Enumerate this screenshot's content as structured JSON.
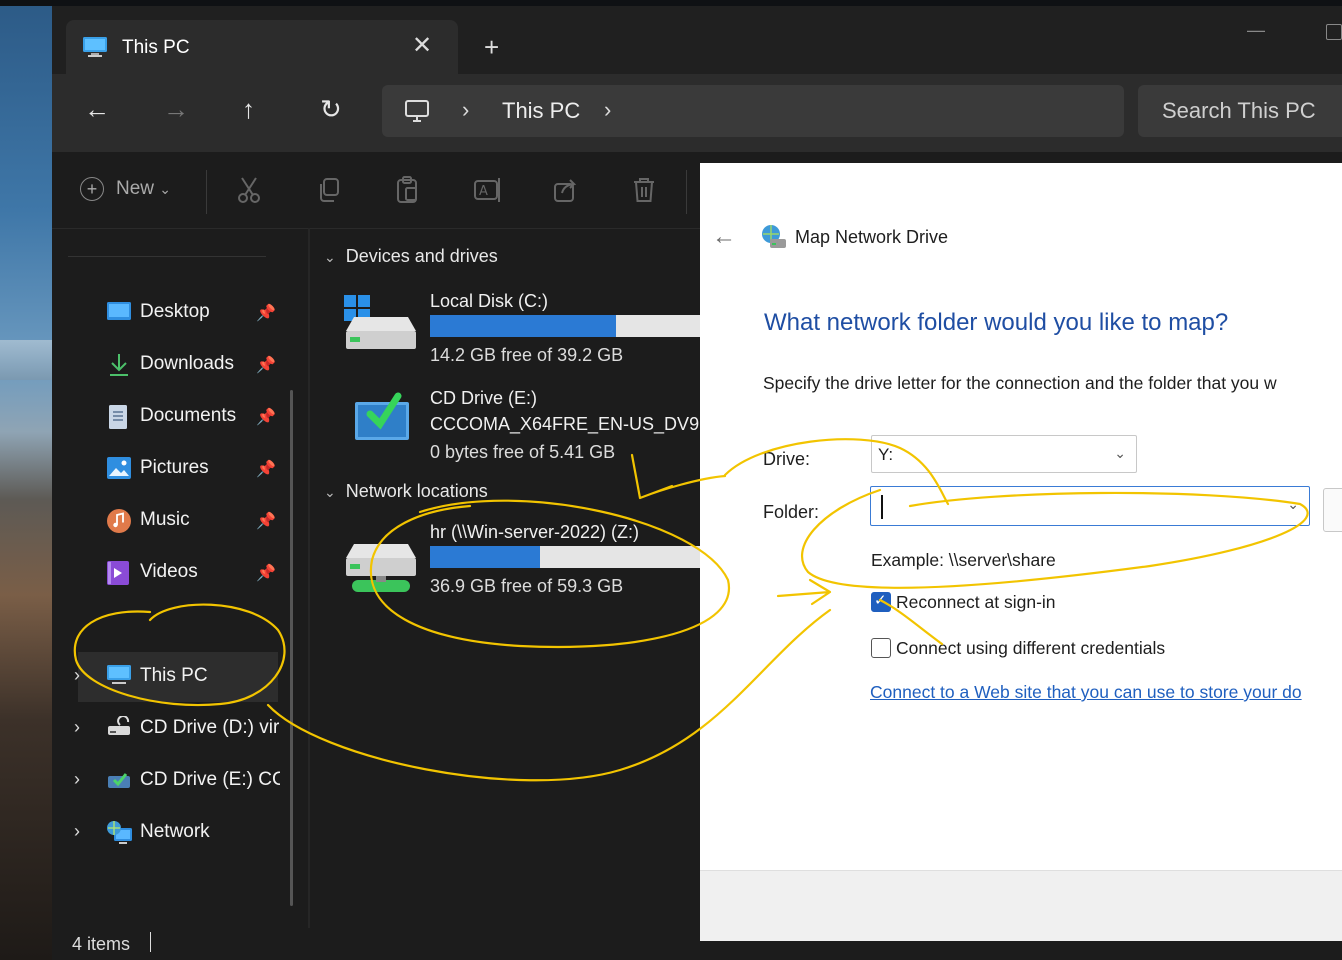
{
  "explorer": {
    "tab_title": "This PC",
    "tab_close": "✕",
    "new_tab": "+",
    "nav": {
      "back": "←",
      "forward": "→",
      "up": "↑",
      "refresh": "↻"
    },
    "address": {
      "sep": "›",
      "crumb": "This PC"
    },
    "search_placeholder": "Search This PC",
    "toolbar": {
      "new_label": "New",
      "new_chevron": "⌄"
    },
    "sidebar": {
      "pin": "📌",
      "chevron": "›",
      "quick_access": [
        {
          "label": "Desktop",
          "icon": "desktop-icon"
        },
        {
          "label": "Downloads",
          "icon": "download-icon"
        },
        {
          "label": "Documents",
          "icon": "document-icon"
        },
        {
          "label": "Pictures",
          "icon": "pictures-icon"
        },
        {
          "label": "Music",
          "icon": "music-icon"
        },
        {
          "label": "Videos",
          "icon": "video-icon"
        }
      ],
      "tree": [
        {
          "label": "This PC",
          "icon": "monitor-icon",
          "selected": true
        },
        {
          "label": "CD Drive (D:) vir",
          "icon": "cd-drive-icon"
        },
        {
          "label": "CD Drive (E:) CC",
          "icon": "cd-drive-icon"
        },
        {
          "label": "Network",
          "icon": "network-icon"
        }
      ]
    },
    "groups": {
      "devices": "Devices and drives",
      "network": "Network locations"
    },
    "drives": {
      "local": {
        "name": "Local Disk (C:)",
        "free": "14.2 GB free of 39.2 GB",
        "used_fraction": 0.64
      },
      "cd": {
        "name": "CD Drive (E:)",
        "label": "CCCOMA_X64FRE_EN-US_DV9",
        "free": "0 bytes free of 5.41 GB"
      },
      "net": {
        "name": "hr (\\\\Win-server-2022) (Z:)",
        "free": "36.9 GB free of 59.3 GB",
        "used_fraction": 0.38
      }
    },
    "status": "4 items"
  },
  "dialog": {
    "back": "←",
    "title": "Map Network Drive",
    "heading": "What network folder would you like to map?",
    "description": "Specify the drive letter for the connection and the folder that you w",
    "drive_label": "Drive:",
    "drive_value": "Y:",
    "folder_label": "Folder:",
    "folder_value": "",
    "combo_arrow": "⌄",
    "example": "Example: \\\\server\\share",
    "reconnect_label": "Reconnect at sign-in",
    "reconnect_checked": true,
    "credentials_label": "Connect using different credentials",
    "credentials_checked": false,
    "link": "Connect to a Web site that you can use to store your do"
  },
  "colors": {
    "accent": "#2b7ad4",
    "annotation": "#f2c400",
    "heading_blue": "#1f4ea3"
  }
}
